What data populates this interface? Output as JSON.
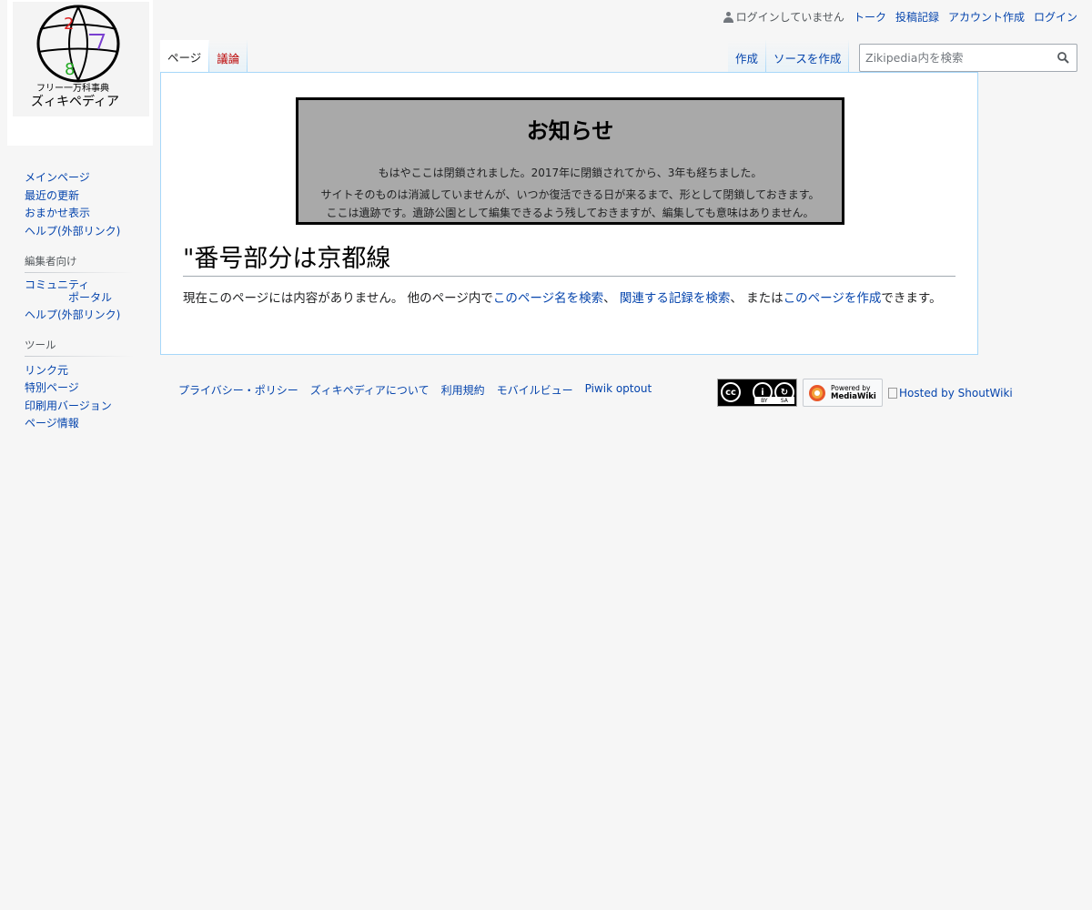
{
  "logo": {
    "numbers": [
      "2",
      "8"
    ],
    "subtitle_small": "フリー一万科事典",
    "subtitle_large": "ズィキペディア"
  },
  "personal": {
    "anon": "ログインしていません",
    "items": [
      "トーク",
      "投稿記録",
      "アカウント作成",
      "ログイン"
    ]
  },
  "tabs_left": [
    {
      "label": "ページ",
      "selected": true
    },
    {
      "label": "議論",
      "new": true
    }
  ],
  "tabs_right": [
    {
      "label": "作成"
    },
    {
      "label": "ソースを作成"
    }
  ],
  "search": {
    "placeholder": "Zikipedia内を検索"
  },
  "sidebar": {
    "navigation": [
      "メインページ",
      "最近の更新",
      "おまかせ表示",
      "ヘルプ(外部リンク)"
    ],
    "editors_heading": "編集者向け",
    "editors": [
      "コミュニティ",
      "ポータル",
      "ヘルプ(外部リンク)"
    ],
    "tools_heading": "ツール",
    "tools": [
      "リンク元",
      "特別ページ",
      "印刷用バージョン",
      "ページ情報"
    ]
  },
  "notice": {
    "title": "お知らせ",
    "line1": "もはやここは閉鎖されました。2017年に閉鎖されてから、3年も経ちました。",
    "line2": "サイトそのものは消滅していませんが、いつか復活できる日が来るまで、形として閉鎖しておきます。",
    "line3": "ここは遺跡です。遺跡公園として編集できるよう残しておきますが、編集しても意味はありません。"
  },
  "page_title": "\"番号部分は京都線",
  "body": {
    "t1": "現在このページには内容がありません。 他のページ内で",
    "link1": "このページ名を検索",
    "t2": "、 ",
    "link2": "関連する記録を検索",
    "t3": "、 または",
    "link3": "このページを作成",
    "t4": "できます。"
  },
  "footer": {
    "links": [
      "プライバシー・ポリシー",
      "ズィキペディアについて",
      "利用規約",
      "モバイルビュー",
      "Piwik optout"
    ],
    "cc_labels": [
      "cc",
      "BY",
      "SA"
    ],
    "mw_line1": "Powered by",
    "mw_line2": "MediaWiki",
    "hosted": "Hosted by ShoutWiki"
  },
  "colors": {
    "link": "#0645ad",
    "new_link": "#ba0000",
    "notice_bg": "#a9a9a9",
    "page_bg": "#f6f6f6"
  }
}
